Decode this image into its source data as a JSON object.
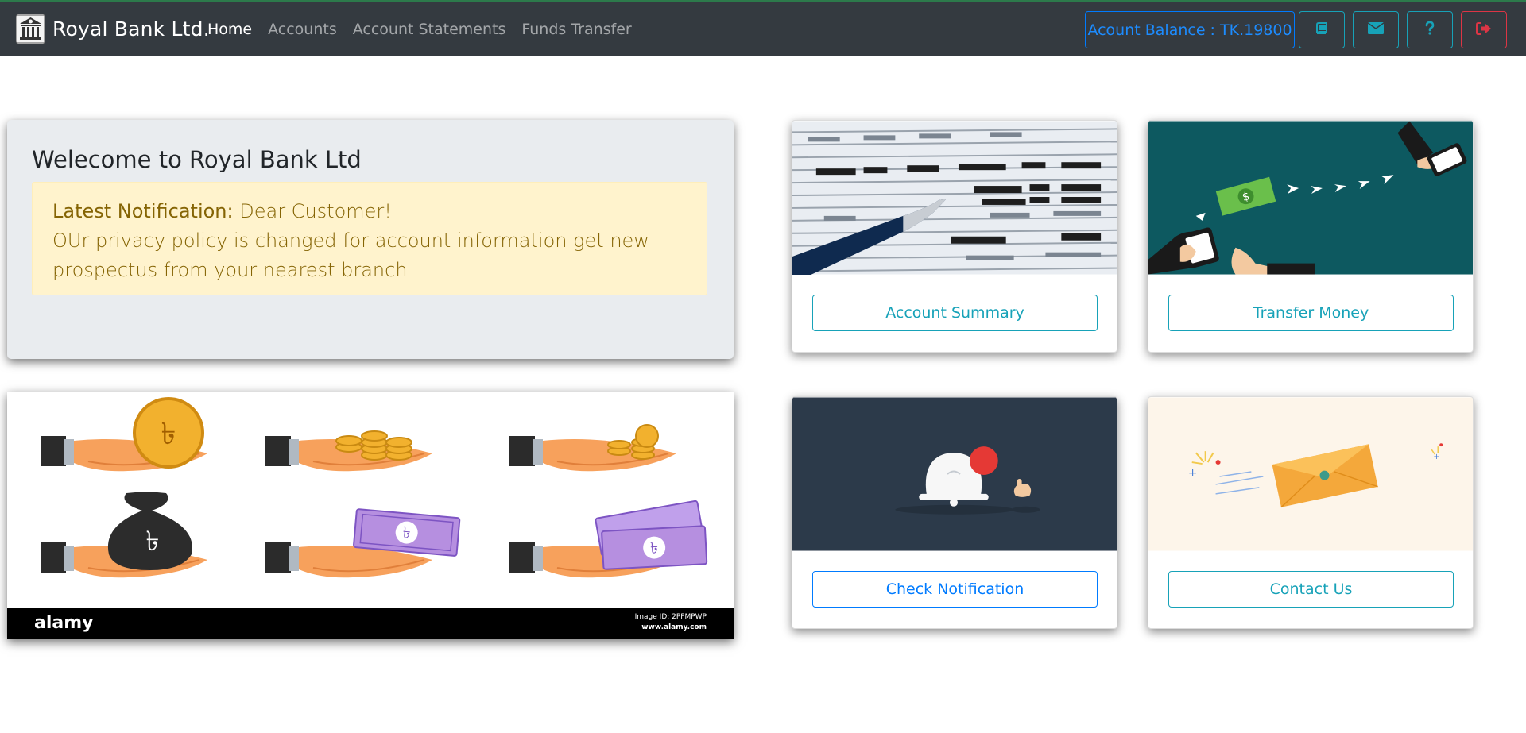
{
  "brand": {
    "name": "Royal Bank Ltd.",
    "logo_icon": "bank-building-icon"
  },
  "nav": {
    "items": [
      {
        "label": "Home",
        "active": true
      },
      {
        "label": "Accounts",
        "active": false
      },
      {
        "label": "Account Statements",
        "active": false
      },
      {
        "label": "Funds Transfer",
        "active": false
      }
    ]
  },
  "toolbar": {
    "balance_label": "Acount Balance : TK.19800",
    "icons": [
      "book-icon",
      "envelope-icon",
      "question-icon",
      "sign-out-icon"
    ]
  },
  "welcome": {
    "title": "Welecome to Royal Bank Ltd",
    "notification_label": "Latest Notification:",
    "notification_greeting": "Dear Customer!",
    "notification_message": "OUr privacy policy is changed for account information get new prospectus from your nearest branch"
  },
  "money_image": {
    "watermark": "alamy",
    "image_id": "Image ID: 2PFMPWP",
    "site": "www.alamy.com"
  },
  "cards": [
    {
      "label": "Account Summary",
      "image": "financial-table-pen-image",
      "style": "teal"
    },
    {
      "label": "Transfer Money",
      "image": "mobile-money-transfer-image",
      "style": "teal"
    },
    {
      "label": "Check Notification",
      "image": "notification-bell-image",
      "style": "blue"
    },
    {
      "label": "Contact Us",
      "image": "envelope-letter-image",
      "style": "teal"
    }
  ],
  "colors": {
    "navbar": "#343a40",
    "primary": "#007bff",
    "info": "#17a2b8",
    "danger": "#dc3545",
    "alert_bg": "#fff3cd",
    "alert_text": "#856404",
    "jumbotron": "#e9ecef"
  }
}
